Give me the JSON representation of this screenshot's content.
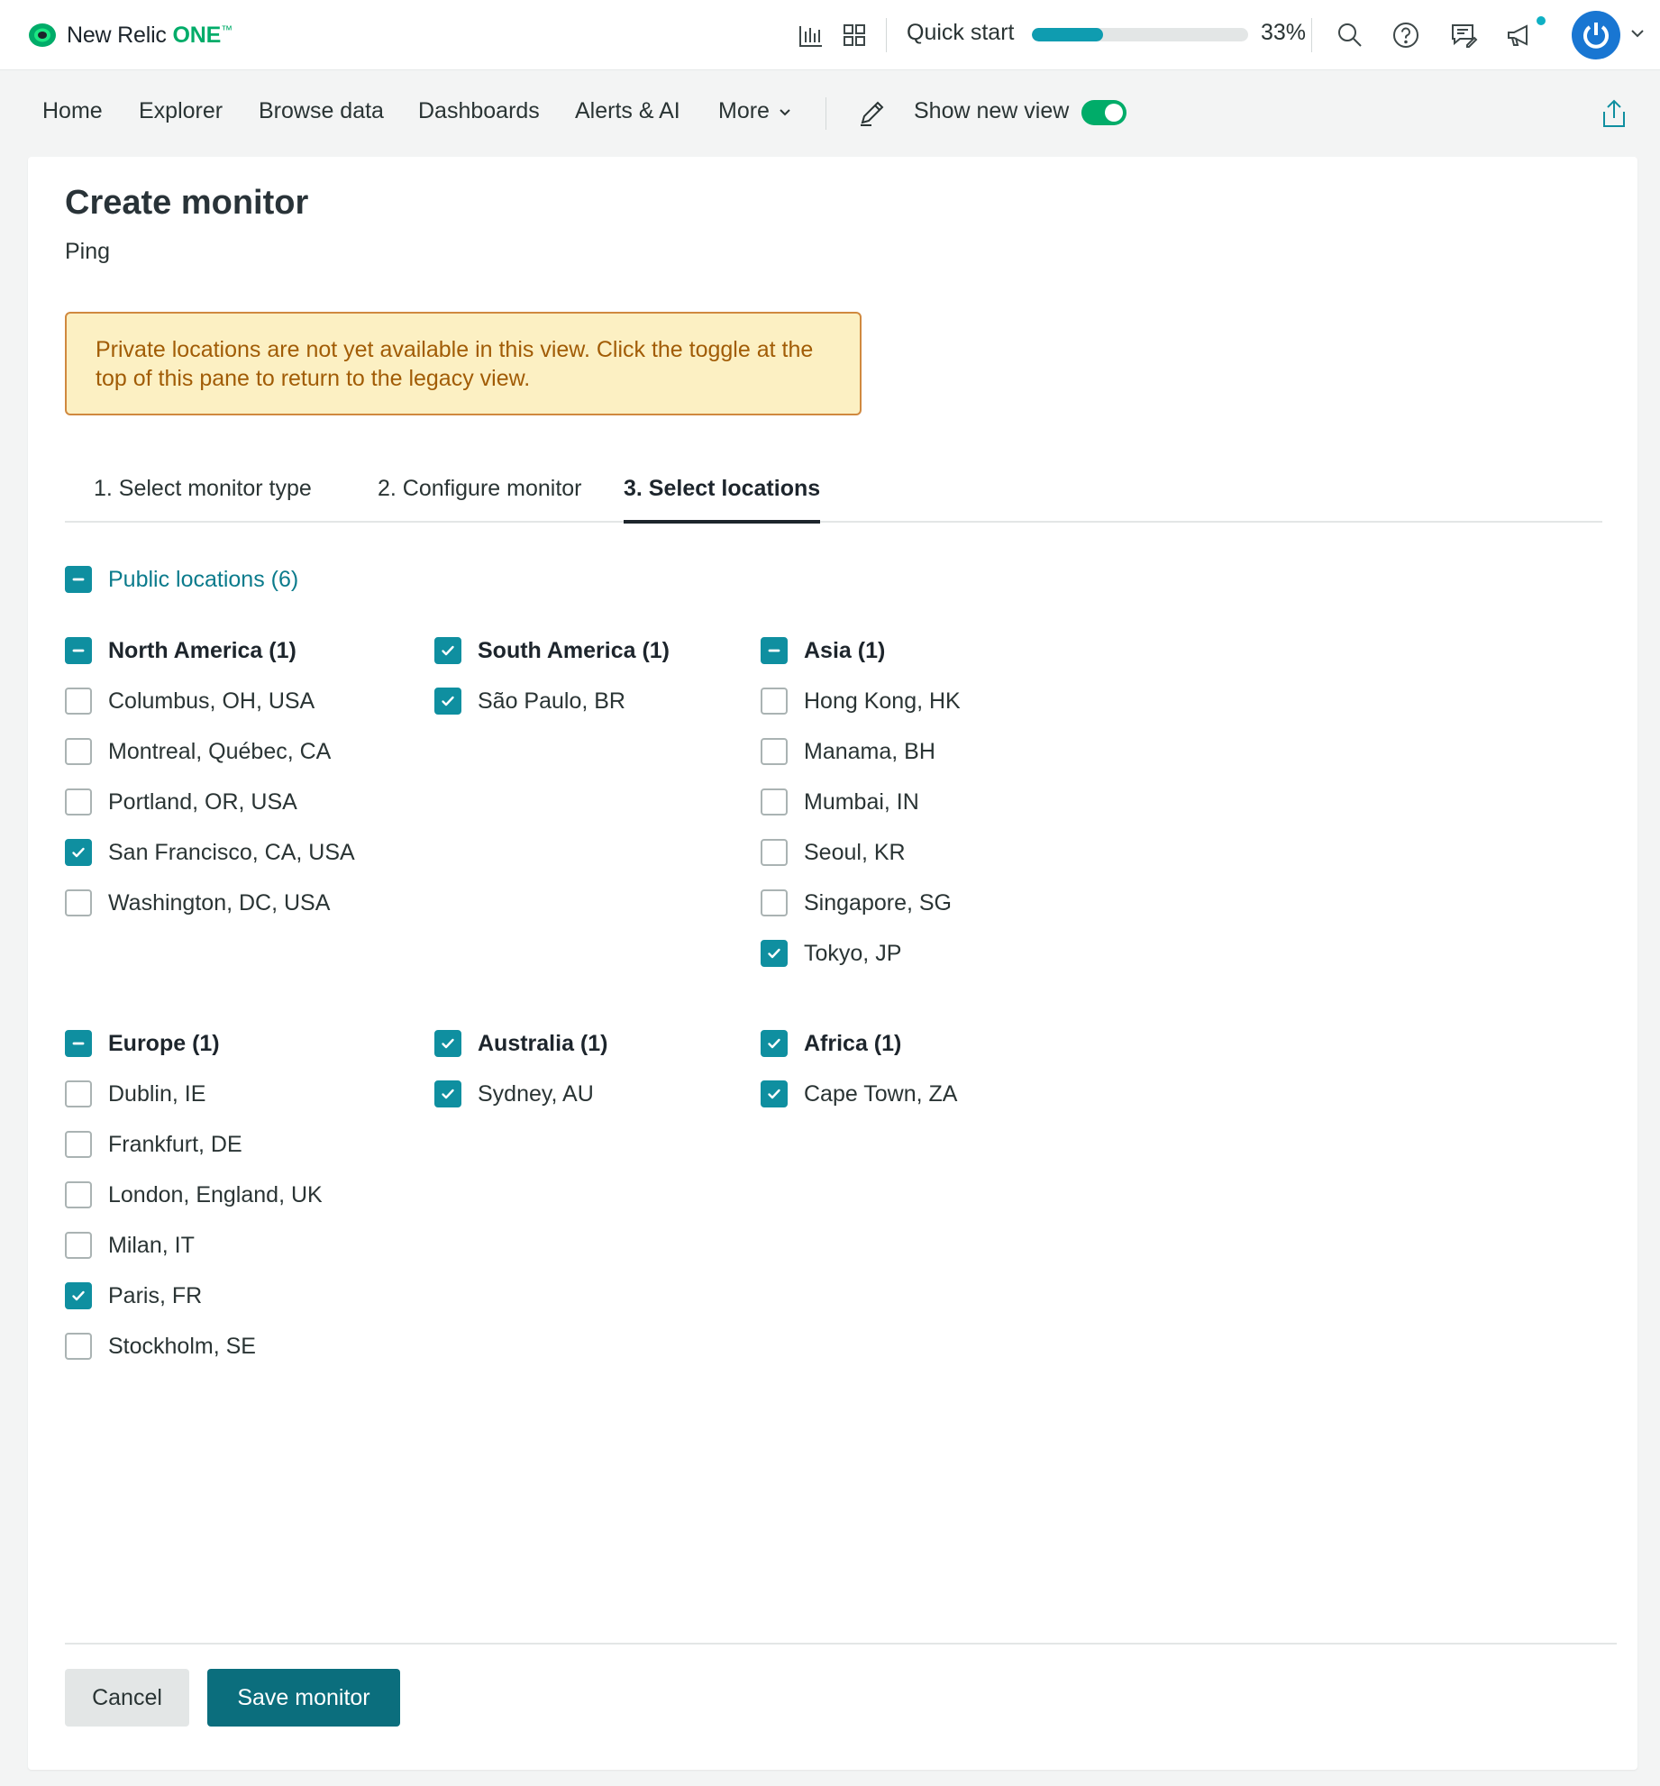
{
  "brand": {
    "name": "New Relic",
    "product": "ONE",
    "tm": "™"
  },
  "topbar": {
    "icons": [
      "bar-chart-icon",
      "apps-grid-icon",
      "search-icon",
      "help-icon",
      "feedback-icon",
      "megaphone-icon",
      "chevron-down-icon"
    ],
    "quick_start": {
      "label": "Quick start",
      "progress_percent": 33,
      "progress_label": "33%"
    }
  },
  "nav": {
    "items": [
      "Home",
      "Explorer",
      "Browse data",
      "Dashboards",
      "Alerts & AI",
      "More"
    ],
    "toggle_label": "Show new view",
    "toggle_on": true
  },
  "page": {
    "title": "Create monitor",
    "subtitle": "Ping",
    "warning": "Private locations are not yet available in this view.  Click the toggle at the top of this pane to return to the legacy view."
  },
  "steps": [
    {
      "label": "1. Select monitor type",
      "active": false
    },
    {
      "label": "2. Configure monitor",
      "active": false
    },
    {
      "label": "3. Select locations",
      "active": true
    }
  ],
  "public_locations": {
    "label": "Public locations (6)",
    "state": "mixed"
  },
  "groups": [
    {
      "label": "North America (1)",
      "state": "mixed",
      "locations": [
        {
          "label": "Columbus, OH, USA",
          "checked": false
        },
        {
          "label": "Montreal, Québec, CA",
          "checked": false
        },
        {
          "label": "Portland, OR, USA",
          "checked": false
        },
        {
          "label": "San Francisco, CA, USA",
          "checked": true
        },
        {
          "label": "Washington, DC, USA",
          "checked": false
        }
      ]
    },
    {
      "label": "South America (1)",
      "state": "checked",
      "locations": [
        {
          "label": "São Paulo, BR",
          "checked": true
        }
      ]
    },
    {
      "label": "Asia (1)",
      "state": "mixed",
      "locations": [
        {
          "label": "Hong Kong, HK",
          "checked": false
        },
        {
          "label": "Manama, BH",
          "checked": false
        },
        {
          "label": "Mumbai, IN",
          "checked": false
        },
        {
          "label": "Seoul, KR",
          "checked": false
        },
        {
          "label": "Singapore, SG",
          "checked": false
        },
        {
          "label": "Tokyo, JP",
          "checked": true
        }
      ]
    },
    {
      "label": "Europe (1)",
      "state": "mixed",
      "locations": [
        {
          "label": "Dublin, IE",
          "checked": false
        },
        {
          "label": "Frankfurt, DE",
          "checked": false
        },
        {
          "label": "London, England, UK",
          "checked": false
        },
        {
          "label": "Milan, IT",
          "checked": false
        },
        {
          "label": "Paris, FR",
          "checked": true
        },
        {
          "label": "Stockholm, SE",
          "checked": false
        }
      ]
    },
    {
      "label": "Australia (1)",
      "state": "checked",
      "locations": [
        {
          "label": "Sydney, AU",
          "checked": true
        }
      ]
    },
    {
      "label": "Africa (1)",
      "state": "checked",
      "locations": [
        {
          "label": "Cape Town, ZA",
          "checked": true
        }
      ]
    }
  ],
  "footer": {
    "cancel_label": "Cancel",
    "save_label": "Save monitor"
  },
  "colors": {
    "accent": "#0f8fa0",
    "primary_button": "#0b6e7d",
    "toggle_on": "#00ac69",
    "warning_bg": "#fcf0c3",
    "warning_border": "#d0893f",
    "warning_text": "#a15c06"
  }
}
